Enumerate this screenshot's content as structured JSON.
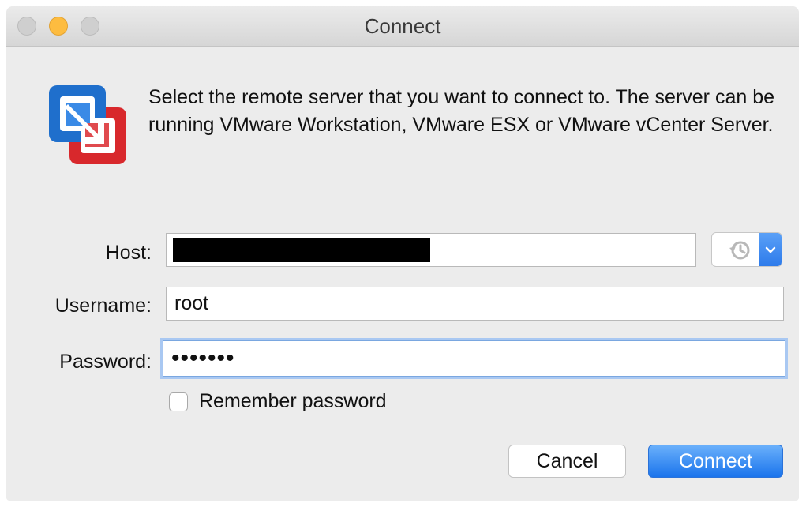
{
  "window": {
    "title": "Connect"
  },
  "message": "Select the remote server that you want to connect to. The server can be running VMware Workstation, VMware ESX or VMware vCenter Server.",
  "form": {
    "host_label": "Host:",
    "host_value": "",
    "username_label": "Username:",
    "username_value": "root",
    "password_label": "Password:",
    "password_masked": "•••••••",
    "remember_label": "Remember password",
    "remember_checked": false
  },
  "buttons": {
    "cancel": "Cancel",
    "connect": "Connect"
  },
  "icons": {
    "app": "vmware-fusion-icon",
    "history": "history-clock-icon",
    "dropdown": "chevron-down-icon"
  },
  "colors": {
    "accent": "#1a74ec",
    "focus_ring": "#a9c8f2",
    "minimize": "#fdbc40",
    "icon_blue": "#1f6fcc",
    "icon_red": "#d8282c"
  }
}
